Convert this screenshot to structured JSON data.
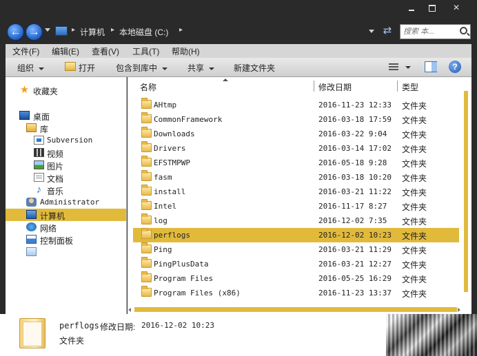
{
  "window": {
    "minimize_label": "",
    "maximize_label": "",
    "close_label": "✕"
  },
  "address": {
    "crumbs": [
      "计算机",
      "本地磁盘 (C:)"
    ],
    "refresh_icon": "refresh-icon"
  },
  "search": {
    "placeholder": "搜索 本..."
  },
  "menu": {
    "items": [
      "文件(F)",
      "编辑(E)",
      "查看(V)",
      "工具(T)",
      "帮助(H)"
    ]
  },
  "toolbar": {
    "organize": "组织",
    "open": "打开",
    "include_library": "包含到库中",
    "share": "共享",
    "new_folder": "新建文件夹",
    "help": "?"
  },
  "nav": {
    "favorites": "收藏夹",
    "desktop": "桌面",
    "library": "库",
    "subversion": "Subversion",
    "video": "视频",
    "pictures": "图片",
    "documents": "文档",
    "music": "音乐",
    "administrator": "Administrator",
    "computer": "计算机",
    "network": "网络",
    "control_panel": "控制面板"
  },
  "columns": {
    "name": "名称",
    "date": "修改日期",
    "type": "类型"
  },
  "files": [
    {
      "name": "AHtmp",
      "date": "2016-11-23 12:33",
      "type": "文件夹"
    },
    {
      "name": "CommonFramework",
      "date": "2016-03-18 17:59",
      "type": "文件夹"
    },
    {
      "name": "Downloads",
      "date": "2016-03-22 9:04",
      "type": "文件夹"
    },
    {
      "name": "Drivers",
      "date": "2016-03-14 17:02",
      "type": "文件夹"
    },
    {
      "name": "EFSTMPWP",
      "date": "2016-05-18 9:28",
      "type": "文件夹"
    },
    {
      "name": "fasm",
      "date": "2016-03-18 10:20",
      "type": "文件夹"
    },
    {
      "name": "install",
      "date": "2016-03-21 11:22",
      "type": "文件夹"
    },
    {
      "name": "Intel",
      "date": "2016-11-17 8:27",
      "type": "文件夹"
    },
    {
      "name": "log",
      "date": "2016-12-02 7:35",
      "type": "文件夹"
    },
    {
      "name": "perflogs",
      "date": "2016-12-02 10:23",
      "type": "文件夹"
    },
    {
      "name": "Ping",
      "date": "2016-03-21 11:29",
      "type": "文件夹"
    },
    {
      "name": "PingPlusData",
      "date": "2016-03-21 12:27",
      "type": "文件夹"
    },
    {
      "name": "Program Files",
      "date": "2016-05-25 16:29",
      "type": "文件夹"
    },
    {
      "name": "Program Files (x86)",
      "date": "2016-11-23 13:37",
      "type": "文件夹"
    }
  ],
  "selected_index": 9,
  "details": {
    "name": "perflogs",
    "date_label": "修改日期:",
    "date": "2016-12-02 10:23",
    "type": "文件夹"
  },
  "colors": {
    "selection": "#e1ba3c",
    "frame": "#2a2a2a"
  }
}
